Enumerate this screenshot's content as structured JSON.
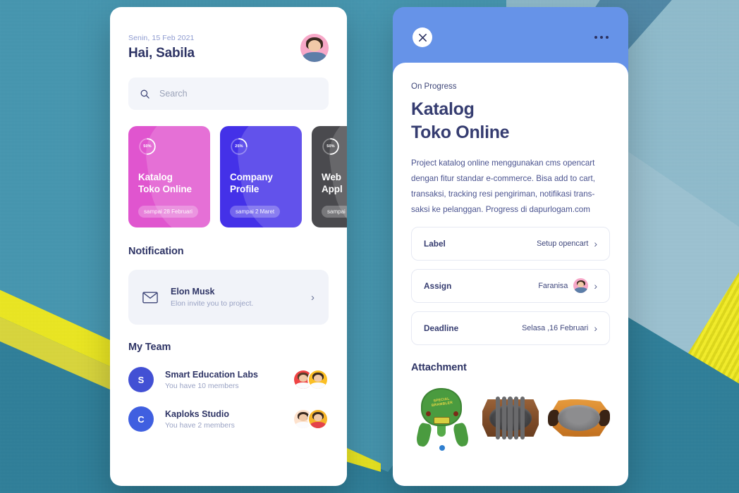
{
  "colors": {
    "brand_blue": "#4250d4",
    "header_blue": "#6693e8",
    "navy_text": "#2e3465",
    "muted_text": "#9aa3c4",
    "card_pink": "#e055cf",
    "card_purple": "#4431e8",
    "card_dark": "#4a4a4e",
    "bg_teal": "#4496b0",
    "bg_yellow": "#ece81f"
  },
  "left_panel": {
    "date": "Senin, 15 Feb 2021",
    "greeting": "Hai, Sabila",
    "avatar_name": "user-avatar",
    "search": {
      "placeholder": "Search",
      "icon": "search-icon"
    },
    "projects": [
      {
        "progress_label": "50%",
        "progress_value": 50,
        "title": "Katalog\nToko Online",
        "title_line1": "Katalog",
        "title_line2": "Toko Online",
        "due_badge": "sampai 28 Februari",
        "color": "#e055cf",
        "color_light": "#ea74da"
      },
      {
        "progress_label": "25%",
        "progress_value": 25,
        "title": "Company\nProfile",
        "title_line1": "Company",
        "title_line2": "Profile",
        "due_badge": "sampai 2 Maret",
        "color": "#4431e8",
        "color_light": "#6050f2"
      },
      {
        "progress_label": "50%",
        "progress_value": 50,
        "title": "Web\nAppl",
        "title_line1": "Web",
        "title_line2": "Appl",
        "due_badge": "sampai",
        "color": "#4a4a4e",
        "color_light": "#5c5c60"
      }
    ],
    "notification": {
      "section_title": "Notification",
      "icon": "envelope-icon",
      "name": "Elon Musk",
      "message": "Elon invite you to project.",
      "chevron": "›"
    },
    "team": {
      "section_title": "My Team",
      "items": [
        {
          "initial": "S",
          "name": "Smart Education Labs",
          "members": "You have 10 members"
        },
        {
          "initial": "C",
          "name": "Kaploks Studio",
          "members": "You have 2 members"
        }
      ]
    }
  },
  "right_panel": {
    "close_icon": "close-icon",
    "more_icon": "more-horizontal-icon",
    "status": "On Progress",
    "title_line1": "Katalog",
    "title_line2": "Toko Online",
    "description": "Project katalog online menggunakan cms opencart dengan fitur standar e-commerce. Bisa add to cart, transaksi, tracking resi pengiriman, notifikasi trans-saksi ke pelanggan. Progress di dapurlogam.com",
    "details": [
      {
        "key": "Label",
        "value": "Setup opencart",
        "has_avatar": false,
        "chevron": "›"
      },
      {
        "key": "Assign",
        "value": "Faranisa",
        "has_avatar": true,
        "chevron": "›"
      },
      {
        "key": "Deadline",
        "value": "Selasa ,16 Februari",
        "has_avatar": false,
        "chevron": "›"
      }
    ],
    "attachment": {
      "section_title": "Attachment",
      "items": [
        {
          "name": "green-cast-iron-product",
          "label": "SPECIAL BRAMBLER"
        },
        {
          "name": "oval-hotplate-dark-wood-tray",
          "label": ""
        },
        {
          "name": "oval-hotplate-light-wood-tray",
          "label": ""
        }
      ]
    }
  }
}
